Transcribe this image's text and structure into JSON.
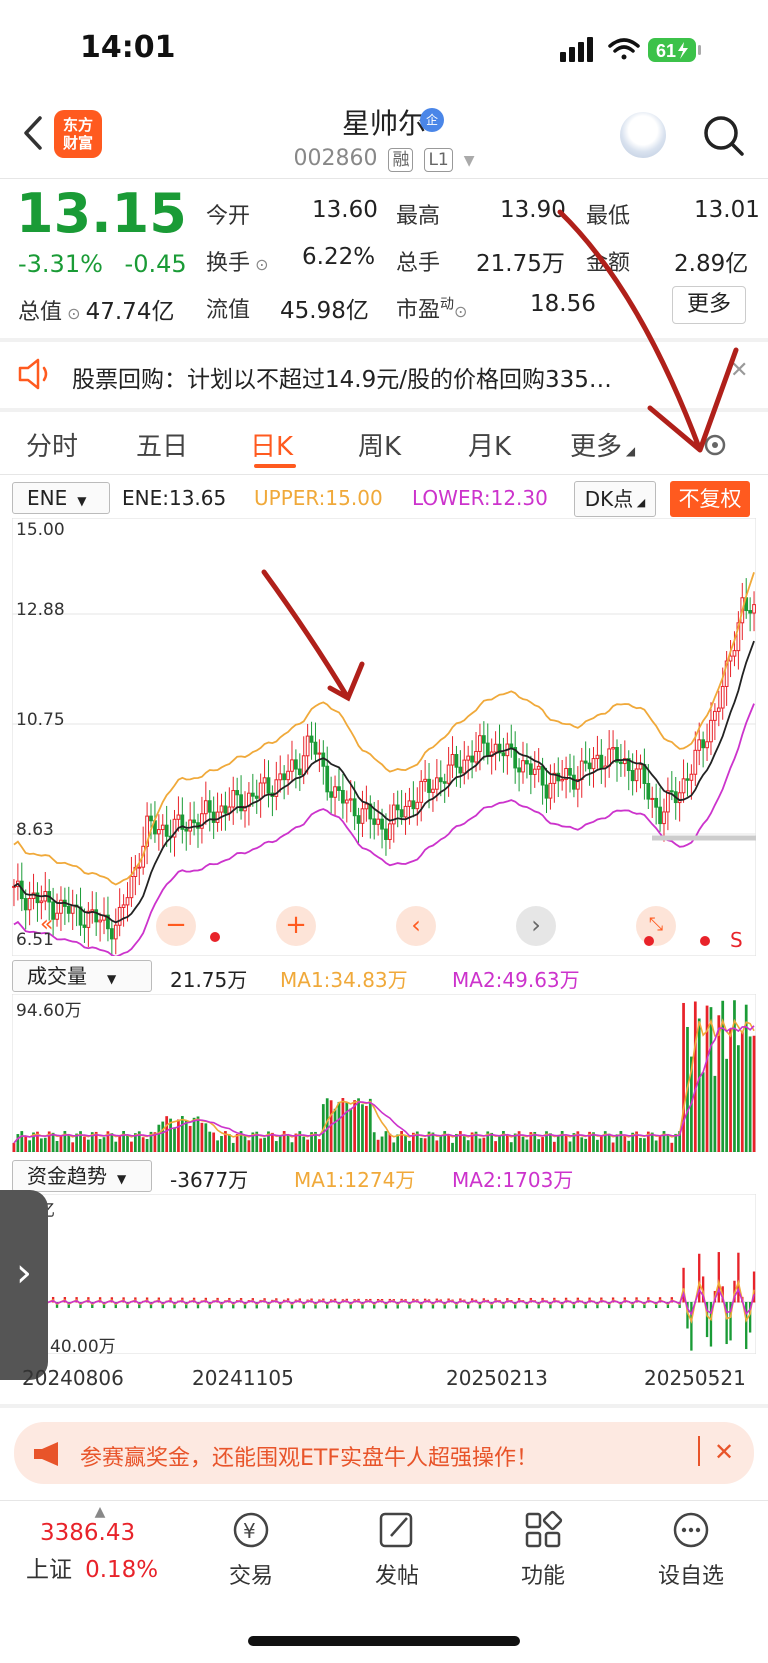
{
  "status_bar": {
    "time": "14:01",
    "battery": "61"
  },
  "header": {
    "stock_name": "星帅尔",
    "name_badge": "企",
    "stock_code": "002860",
    "tags": [
      "融",
      "L1"
    ],
    "logo_text": [
      "东方",
      "财富"
    ]
  },
  "quote": {
    "price": "13.15",
    "change_pct": "-3.31%",
    "change_abs": "-0.45",
    "total_value_label": "总值",
    "total_value": "47.74亿",
    "open_label": "今开",
    "open": "13.60",
    "high_label": "最高",
    "high": "13.90",
    "low_label": "最低",
    "low": "13.01",
    "turnover_label": "换手",
    "turnover": "6.22%",
    "volume_label": "总手",
    "volume": "21.75万",
    "amount_label": "金额",
    "amount": "2.89亿",
    "float_value_label": "流值",
    "float_value": "45.98亿",
    "pe_label": "市盈",
    "pe_sup": "动",
    "pe": "18.56",
    "more_label": "更多"
  },
  "notice": {
    "text": "股票回购：计划以不超过14.9元/股的价格回购335…"
  },
  "tabs": [
    "分时",
    "五日",
    "日K",
    "周K",
    "月K",
    "更多"
  ],
  "indicator_ene": {
    "selector": "ENE",
    "ene": "ENE:13.65",
    "upper": "UPPER:15.00",
    "lower": "LOWER:12.30",
    "dk_label": "DK点",
    "fq_label": "不复权"
  },
  "price_axis": [
    "15.00",
    "12.88",
    "10.75",
    "8.63",
    "6.51"
  ],
  "indicator_volume": {
    "selector": "成交量",
    "value": "21.75万",
    "ma1": "MA1:34.83万",
    "ma2": "MA2:49.63万",
    "axis_top": "94.60万"
  },
  "indicator_fund": {
    "selector": "资金趋势",
    "value": "-3677万",
    "ma1": "MA1:1274万",
    "ma2": "MA2:1703万",
    "axis_top": "亿",
    "axis_bottom": "40.00万"
  },
  "dates": [
    "20240806",
    "20241105",
    "20250213",
    "20250521"
  ],
  "chart_controls": {
    "right_letter": "S"
  },
  "promo": {
    "text": "参赛赢奖金，还能围观ETF实盘牛人超强操作！"
  },
  "bottom_nav": {
    "index_value": "3386.43",
    "index_name": "上证",
    "index_change": "0.18%",
    "items": [
      "交易",
      "发帖",
      "功能",
      "设自选"
    ]
  },
  "colors": {
    "accent": "#ff5a1f",
    "up": "#e8232a",
    "down": "#1a9b36",
    "ma_yellow": "#f0a93a",
    "ma_magenta": "#cc33cc"
  }
}
